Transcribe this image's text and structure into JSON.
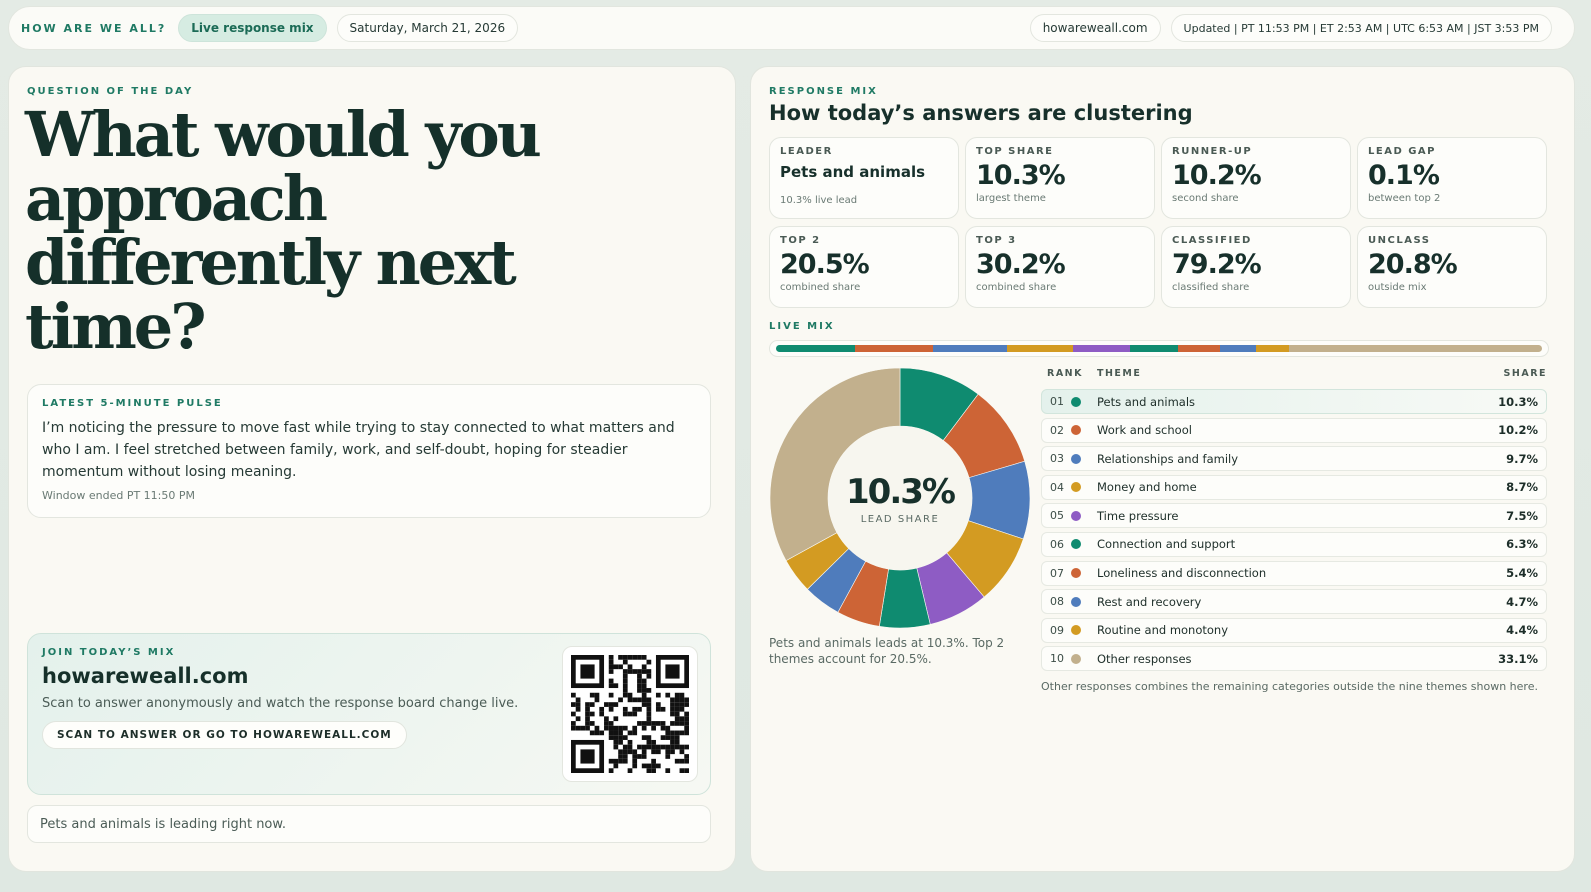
{
  "topbar": {
    "brand": "HOW ARE WE ALL?",
    "live_label": "Live response mix",
    "date": "Saturday, March 21, 2026",
    "site": "howareweall.com",
    "updated": "Updated | PT 11:53 PM | ET 2:53 AM | UTC 6:53 AM | JST 3:53 PM"
  },
  "question": {
    "eyebrow": "QUESTION OF THE DAY",
    "text": "What would you approach differently next time?"
  },
  "pulse": {
    "eyebrow": "LATEST 5-MINUTE PULSE",
    "text": "I’m noticing the pressure to move fast while trying to stay connected to what matters and who I am. I feel stretched between family, work, and self-doubt, hoping for steadier momentum without losing meaning.",
    "footer": "Window ended PT 11:50 PM"
  },
  "join": {
    "eyebrow": "JOIN TODAY’S MIX",
    "url": "howareweall.com",
    "description": "Scan to answer anonymously and watch the response board change live.",
    "button": "SCAN TO ANSWER OR GO TO HOWAREWEALL.COM"
  },
  "leading_note": "Pets and animals is leading right now.",
  "response": {
    "eyebrow": "RESPONSE MIX",
    "title": "How today’s answers are clustering",
    "stats": [
      {
        "label": "LEADER",
        "value": "Pets and animals",
        "sub": "10.3% live lead"
      },
      {
        "label": "TOP SHARE",
        "value": "10.3%",
        "sub": "largest theme"
      },
      {
        "label": "RUNNER-UP",
        "value": "10.2%",
        "sub": "second share"
      },
      {
        "label": "LEAD GAP",
        "value": "0.1%",
        "sub": "between top 2"
      },
      {
        "label": "TOP 2",
        "value": "20.5%",
        "sub": "combined share"
      },
      {
        "label": "TOP 3",
        "value": "30.2%",
        "sub": "combined share"
      },
      {
        "label": "CLASSIFIED",
        "value": "79.2%",
        "sub": "classified share"
      },
      {
        "label": "UNCLASS",
        "value": "20.8%",
        "sub": "outside mix"
      }
    ],
    "mix_label": "LIVE MIX",
    "donut_value": "10.3%",
    "donut_label": "LEAD SHARE",
    "donut_note": "Pets and animals leads at 10.3%. Top 2 themes account for 20.5%.",
    "table_headers": {
      "rank": "RANK",
      "theme": "THEME",
      "share": "SHARE"
    },
    "table_footer": "Other responses combines the remaining categories outside the nine themes shown here."
  },
  "chart_data": {
    "type": "pie",
    "categories": [
      "Pets and animals",
      "Work and school",
      "Relationships and family",
      "Money and home",
      "Time pressure",
      "Connection and support",
      "Loneliness and disconnection",
      "Rest and recovery",
      "Routine and monotony",
      "Other responses"
    ],
    "ranks": [
      "01",
      "02",
      "03",
      "04",
      "05",
      "06",
      "07",
      "08",
      "09",
      "10"
    ],
    "values": [
      10.3,
      10.2,
      9.7,
      8.7,
      7.5,
      6.3,
      5.4,
      4.7,
      4.4,
      33.1
    ],
    "labels": [
      "10.3%",
      "10.2%",
      "9.7%",
      "8.7%",
      "7.5%",
      "6.3%",
      "5.4%",
      "4.7%",
      "4.4%",
      "33.1%"
    ],
    "colors": [
      "#0f8b70",
      "#cd6436",
      "#4f7cbc",
      "#d39b22",
      "#8e5cc4",
      "#0f8b70",
      "#cd6436",
      "#4f7cbc",
      "#d39b22",
      "#c2b08d"
    ]
  },
  "qr_icon": "qr-code-icon"
}
